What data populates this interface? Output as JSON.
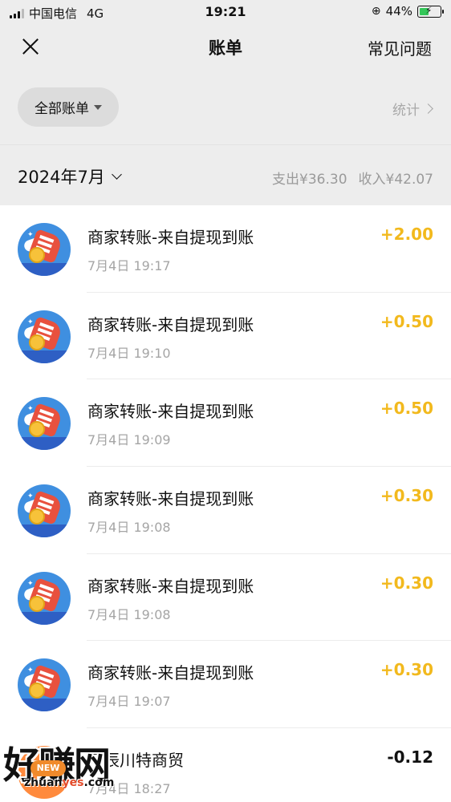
{
  "status_bar": {
    "carrier": "中国电信",
    "network": "4G",
    "time": "19:21",
    "battery": "44%",
    "battery_level": 0.44
  },
  "nav": {
    "title": "账单",
    "faq_label": "常见问题"
  },
  "filter": {
    "label": "全部账单",
    "stats_label": "统计"
  },
  "month": {
    "label": "2024年7月",
    "expense": "支出¥36.30",
    "income": "收入¥42.07"
  },
  "transactions": [
    {
      "title": "商家转账-来自提现到账",
      "time": "7月4日 19:17",
      "amount": "+2.00"
    },
    {
      "title": "商家转账-来自提现到账",
      "time": "7月4日 19:10",
      "amount": "+0.50"
    },
    {
      "title": "商家转账-来自提现到账",
      "time": "7月4日 19:09",
      "amount": "+0.50"
    },
    {
      "title": "商家转账-来自提现到账",
      "time": "7月4日 19:08",
      "amount": "+0.30"
    },
    {
      "title": "商家转账-来自提现到账",
      "time": "7月4日 19:08",
      "amount": "+0.30"
    },
    {
      "title": "商家转账-来自提现到账",
      "time": "7月4日 19:07",
      "amount": "+0.30"
    },
    {
      "title": "阿辰川特商贸",
      "time": "7月4日 18:27",
      "amount": "-0.12"
    }
  ],
  "watermark": {
    "text": "好赚网",
    "url_prefix": "zhuan",
    "url_highlight": "yes",
    "url_suffix": ".com"
  },
  "colors": {
    "income": "#f2b91d",
    "expense": "#111111",
    "background": "#ededed"
  }
}
